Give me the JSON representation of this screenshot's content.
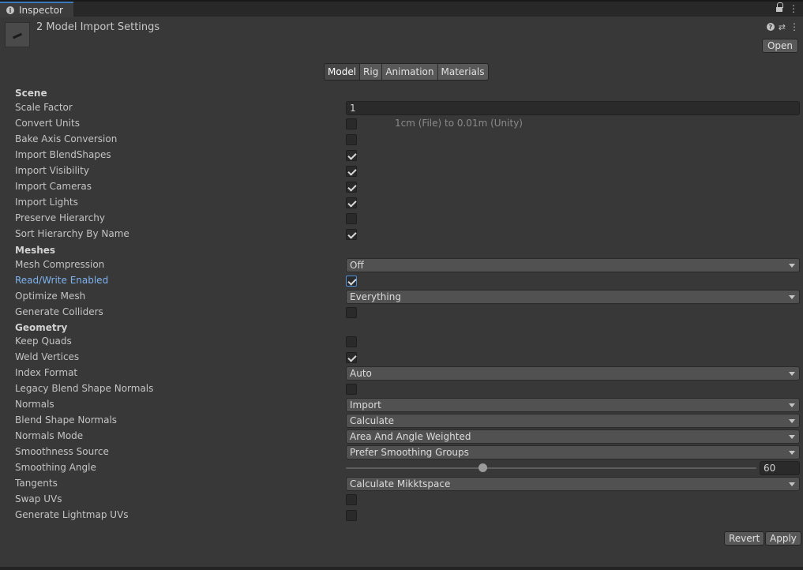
{
  "window": {
    "tab_label": "Inspector"
  },
  "header": {
    "title": "2 Model Import Settings",
    "open_label": "Open"
  },
  "tabs": [
    {
      "label": "Model",
      "active": true
    },
    {
      "label": "Rig",
      "active": false
    },
    {
      "label": "Animation",
      "active": false
    },
    {
      "label": "Materials",
      "active": false
    }
  ],
  "sections": {
    "scene": "Scene",
    "meshes": "Meshes",
    "geometry": "Geometry"
  },
  "fields": {
    "scale_factor": {
      "label": "Scale Factor",
      "value": "1"
    },
    "convert_units": {
      "label": "Convert Units",
      "checked": false,
      "note": "1cm (File) to 0.01m (Unity)"
    },
    "bake_axis_conversion": {
      "label": "Bake Axis Conversion",
      "checked": false
    },
    "import_blendshapes": {
      "label": "Import BlendShapes",
      "checked": true
    },
    "import_visibility": {
      "label": "Import Visibility",
      "checked": true
    },
    "import_cameras": {
      "label": "Import Cameras",
      "checked": true
    },
    "import_lights": {
      "label": "Import Lights",
      "checked": true
    },
    "preserve_hierarchy": {
      "label": "Preserve Hierarchy",
      "checked": false
    },
    "sort_hierarchy": {
      "label": "Sort Hierarchy By Name",
      "checked": true
    },
    "mesh_compression": {
      "label": "Mesh Compression",
      "value": "Off"
    },
    "read_write": {
      "label": "Read/Write Enabled",
      "checked": true
    },
    "optimize_mesh": {
      "label": "Optimize Mesh",
      "value": "Everything"
    },
    "generate_colliders": {
      "label": "Generate Colliders",
      "checked": false
    },
    "keep_quads": {
      "label": "Keep Quads",
      "checked": false
    },
    "weld_vertices": {
      "label": "Weld Vertices",
      "checked": true
    },
    "index_format": {
      "label": "Index Format",
      "value": "Auto"
    },
    "legacy_blend_shape_normals": {
      "label": "Legacy Blend Shape Normals",
      "checked": false
    },
    "normals": {
      "label": "Normals",
      "value": "Import"
    },
    "blend_shape_normals": {
      "label": "Blend Shape Normals",
      "value": "Calculate"
    },
    "normals_mode": {
      "label": "Normals Mode",
      "value": "Area And Angle Weighted"
    },
    "smoothness_source": {
      "label": "Smoothness Source",
      "value": "Prefer Smoothing Groups"
    },
    "smoothing_angle": {
      "label": "Smoothing Angle",
      "value": "60",
      "fraction": 0.333
    },
    "tangents": {
      "label": "Tangents",
      "value": "Calculate Mikktspace"
    },
    "swap_uvs": {
      "label": "Swap UVs",
      "checked": false
    },
    "generate_lightmap_uvs": {
      "label": "Generate Lightmap UVs",
      "checked": false
    }
  },
  "buttons": {
    "revert": "Revert",
    "apply": "Apply"
  }
}
